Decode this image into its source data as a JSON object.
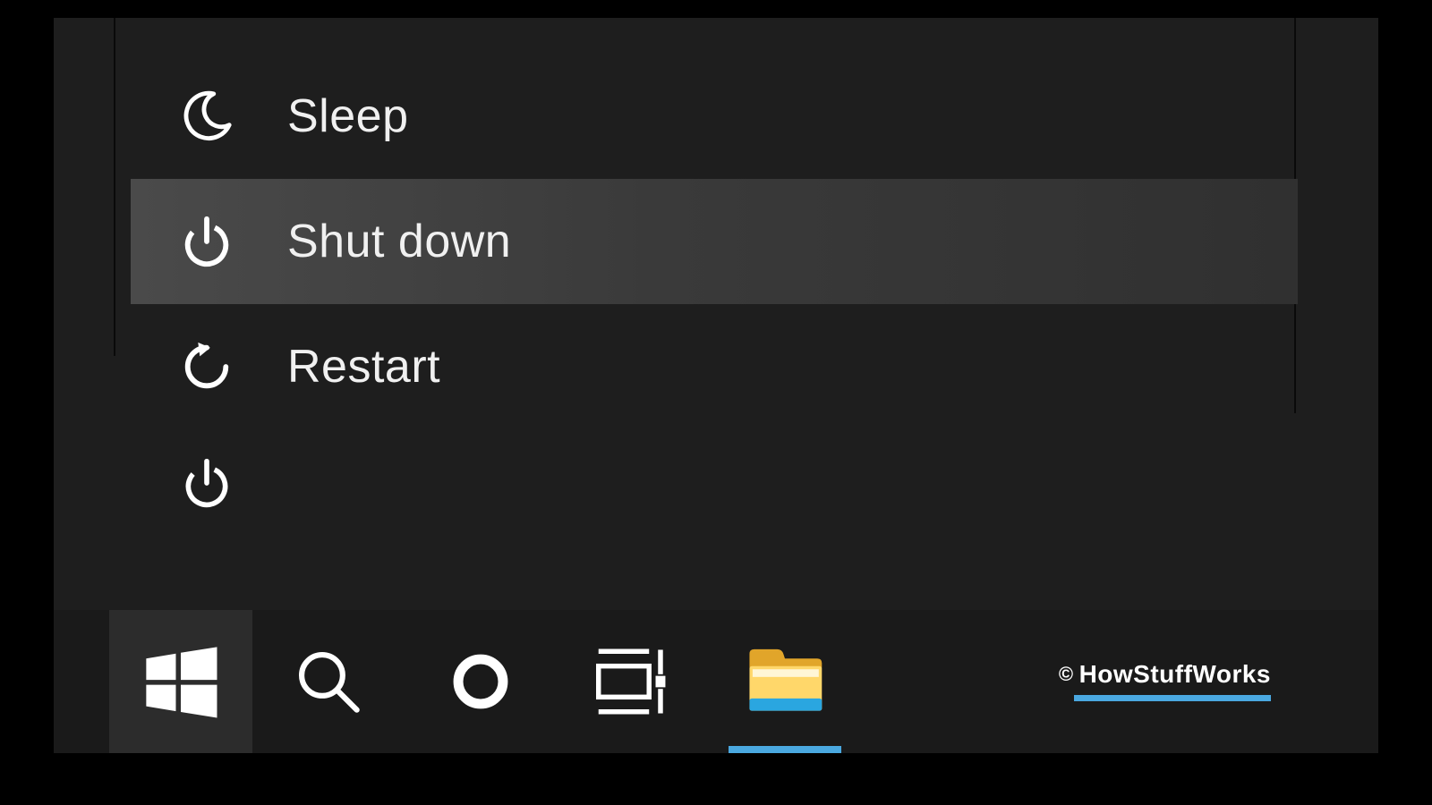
{
  "power_menu": {
    "items": [
      {
        "id": "sleep",
        "label": "Sleep",
        "icon": "moon-icon",
        "hovered": false
      },
      {
        "id": "shutdown",
        "label": "Shut down",
        "icon": "power-icon",
        "hovered": true
      },
      {
        "id": "restart",
        "label": "Restart",
        "icon": "restart-icon",
        "hovered": false
      }
    ],
    "trigger_icon": "power-icon"
  },
  "taskbar": {
    "buttons": [
      {
        "id": "start",
        "icon": "windows-start-icon",
        "active_indicator": false,
        "highlighted": true
      },
      {
        "id": "search",
        "icon": "search-icon",
        "active_indicator": false,
        "highlighted": false
      },
      {
        "id": "cortana",
        "icon": "cortana-ring-icon",
        "active_indicator": false,
        "highlighted": false
      },
      {
        "id": "task-view",
        "icon": "task-view-icon",
        "active_indicator": false,
        "highlighted": false
      },
      {
        "id": "file-explorer",
        "icon": "file-explorer-icon",
        "active_indicator": true,
        "highlighted": false
      }
    ]
  },
  "attribution": {
    "symbol": "©",
    "text": "HowStuffWorks"
  }
}
